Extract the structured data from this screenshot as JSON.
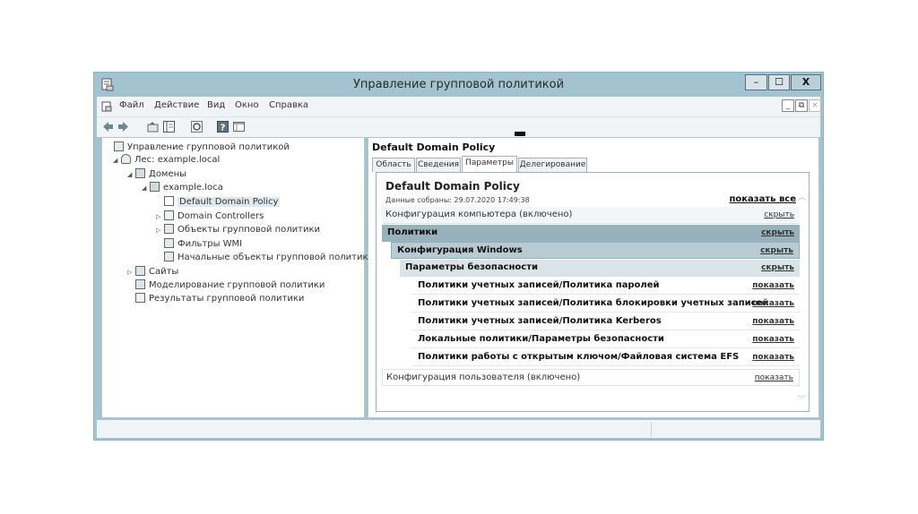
{
  "window": {
    "title": "Управление групповой политикой",
    "controls": {
      "minimize": "–",
      "maximize": "☐",
      "close": "X"
    },
    "mdi_controls": {
      "minimize": "_",
      "restore": "⧉",
      "close": "×"
    }
  },
  "menu": {
    "items": [
      "Файл",
      "Действие",
      "Вид",
      "Окно",
      "Справка"
    ]
  },
  "toolbar": {
    "icons": [
      "back-arrow-icon",
      "forward-arrow-icon",
      "up-folder-icon",
      "show-hide-tree-icon",
      "refresh-icon",
      "help-icon",
      "console-icon"
    ]
  },
  "tree": {
    "items": [
      {
        "label": "Управление групповой политикой",
        "arrow": "",
        "icon": "gpm-icon"
      },
      {
        "label": "Лес: example.local",
        "arrow": "◢",
        "icon": "forest-icon"
      },
      {
        "label": "Домены",
        "arrow": "◢",
        "icon": "domains-icon"
      },
      {
        "label": "example.loca",
        "arrow": "◢",
        "icon": "domain-icon"
      },
      {
        "label": "Default Domain Policy",
        "arrow": "",
        "icon": "gpo-link-icon"
      },
      {
        "label": "Domain Controllers",
        "arrow": "▷",
        "icon": "ou-icon"
      },
      {
        "label": "Объекты групповой политики",
        "arrow": "▷",
        "icon": "gpo-folder-icon"
      },
      {
        "label": "Фильтры WMI",
        "arrow": "",
        "icon": "wmi-icon"
      },
      {
        "label": "Начальные объекты групповой политики",
        "arrow": "",
        "icon": "starter-gpo-icon"
      },
      {
        "label": "Сайты",
        "arrow": "▷",
        "icon": "sites-icon"
      },
      {
        "label": "Моделирование групповой политики",
        "arrow": "",
        "icon": "modeling-icon"
      },
      {
        "label": "Результаты групповой политики",
        "arrow": "",
        "icon": "results-icon"
      }
    ]
  },
  "details": {
    "title": "Default Domain Policy",
    "tabs": [
      "Область",
      "Сведения",
      "Параметры",
      "Делегирование"
    ],
    "active_tab": "Параметры",
    "report": {
      "title": "Default Domain Policy",
      "date": "Данные собраны: 29.07.2020 17:49:38",
      "show_all": "показать все",
      "rows": [
        {
          "label": "Конфигурация компьютера (включено)",
          "link": "скрыть"
        },
        {
          "label": "Политики",
          "link": "скрыть"
        },
        {
          "label": "Конфигурация Windows",
          "link": "скрыть"
        },
        {
          "label": "Параметры безопасности",
          "link": "скрыть"
        },
        {
          "label": "Политики учетных записей/Политика паролей",
          "link": "показать"
        },
        {
          "label": "Политики учетных записей/Политика блокировки учетных записей",
          "link": "показать"
        },
        {
          "label": "Политики учетных записей/Политика Kerberos",
          "link": "показать"
        },
        {
          "label": "Локальные политики/Параметры безопасности",
          "link": "показать"
        },
        {
          "label": "Политики работы с открытым ключом/Файловая система EFS",
          "link": "показать"
        },
        {
          "label": "Конфигурация пользователя (включено)",
          "link": "показать"
        }
      ]
    }
  },
  "colors": {
    "frame": "#a3c3d0",
    "politics_row": "#99b1bb",
    "windows_row": "#b8cad2",
    "security_row": "#d9e4e9"
  }
}
